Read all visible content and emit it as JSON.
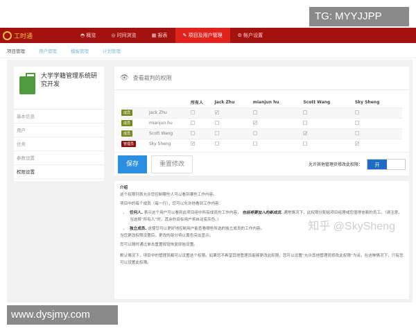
{
  "watermarks": {
    "top": "TG: MYYJJPP",
    "bottom": "www.dysjmy.com",
    "overlay": "知乎 @SkySheng"
  },
  "nav": {
    "logo": "工时通",
    "items": [
      {
        "icon": "dashboard-icon",
        "label": "概览"
      },
      {
        "icon": "clock-icon",
        "label": "时间浏览"
      },
      {
        "icon": "chart-icon",
        "label": "报表"
      },
      {
        "icon": "wrench-icon",
        "label": "项目及用户管理",
        "active": true
      },
      {
        "icon": "gear-icon",
        "label": "帐户设置"
      }
    ]
  },
  "subnav": [
    "项目管理",
    "用户管理",
    "模板管理",
    "计划管理"
  ],
  "sidebar": {
    "project_title": "大学学籍管理系统研究开发",
    "items": [
      "基本信息",
      "用户",
      "任务",
      "参数设置",
      "权限设置"
    ],
    "active": "权限设置"
  },
  "panel": {
    "title": "查看裁判的权限",
    "columns": [
      "所有人",
      "Jack Zhu",
      "mianjun hu",
      "Scott Wang",
      "Sky Sheng"
    ],
    "rows": [
      {
        "role": "成员",
        "role_color": "#7b8a1e",
        "name": "Jack Zhu",
        "checks": [
          false,
          true,
          false,
          false,
          false
        ]
      },
      {
        "role": "成员",
        "role_color": "#7b8a1e",
        "name": "mianjun hu",
        "checks": [
          false,
          false,
          true,
          false,
          false
        ]
      },
      {
        "role": "成员",
        "role_color": "#7b8a1e",
        "name": "Scott Wang",
        "checks": [
          false,
          false,
          false,
          true,
          false
        ]
      },
      {
        "role": "管理员",
        "role_color": "#8b1010",
        "name": "Sky Sheng",
        "checks": [
          true,
          false,
          false,
          false,
          true
        ]
      }
    ],
    "save": "保存",
    "reset": "重置修改",
    "allow_label": "允许其他管理员修改此权限：",
    "toggle_on": "开"
  },
  "intro": {
    "title": "介绍",
    "p1": "这个权限列表允许您控制哪些人可以看到哪些工作内容。",
    "p2": "项目中的每个成员（每一行），您可以允许他看到工作内容：",
    "b1_term": "任何人.",
    "b1_text": "表示这个用户可以看到此项目组中所有成员的工作内容，",
    "b1_em": "包括将要加入的新成员.",
    "b1_rest": "通常情况下，此权限分配给项目经理或您值得信赖的员工。（请注意，当选择“所有人”时，其余的目标用户将自动变灰色。）",
    "b2_term": "独立成员.",
    "b2_text": "这使您可以更好地控制用户能查看哪些所选的独立成员的工作内容。",
    "p3": "当您更改权限设置后，更改的部分将以黄色突出显示。",
    "p4": "您可以随时通过单击重置按钮恢复原始设置。",
    "p5": "默认情况下，项目中的管理员都可以设置这个权限。如果您不希望其他管理员能够更改此权限，您可以设置“允许其他管理员修改此权限”为关。在这种情况下，只有您可以设置此权限。"
  }
}
